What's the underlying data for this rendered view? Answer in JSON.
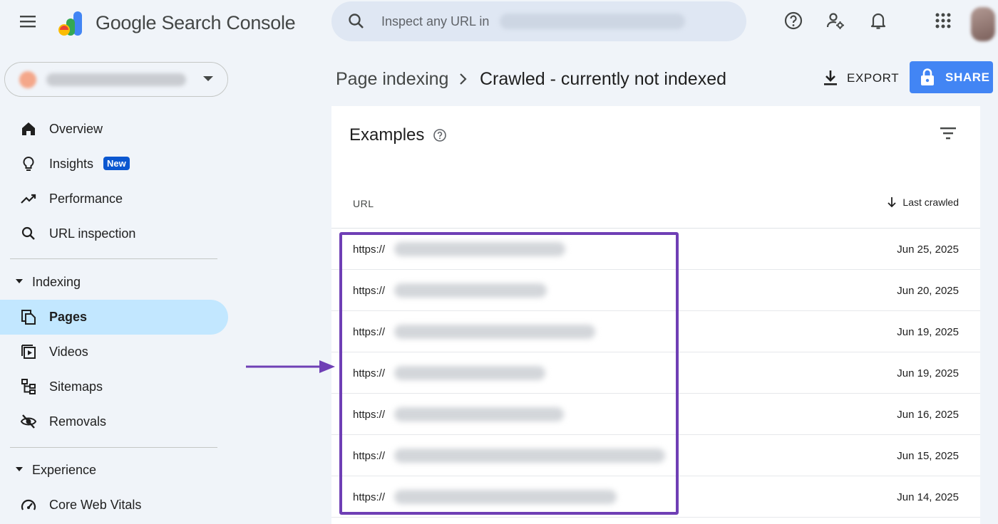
{
  "topbar": {
    "brand": "Google Search Console",
    "search_placeholder": "Inspect any URL in",
    "icons": [
      "menu-icon",
      "help-icon",
      "manage-users-icon",
      "notifications-icon",
      "apps-icon",
      "avatar"
    ]
  },
  "sidebar": {
    "items": [
      {
        "label": "Overview",
        "icon": "home-icon"
      },
      {
        "label": "Insights",
        "icon": "lightbulb-icon",
        "badge": "New"
      },
      {
        "label": "Performance",
        "icon": "trending-icon"
      },
      {
        "label": "URL inspection",
        "icon": "search-icon"
      }
    ],
    "indexing": {
      "label": "Indexing",
      "items": [
        {
          "label": "Pages",
          "icon": "pages-icon",
          "active": true
        },
        {
          "label": "Videos",
          "icon": "video-icon"
        },
        {
          "label": "Sitemaps",
          "icon": "sitemap-icon"
        },
        {
          "label": "Removals",
          "icon": "eye-off-icon"
        }
      ]
    },
    "experience": {
      "label": "Experience",
      "items": [
        {
          "label": "Core Web Vitals",
          "icon": "gauge-icon"
        }
      ]
    }
  },
  "header": {
    "breadcrumb_parent": "Page indexing",
    "breadcrumb_current": "Crawled - currently not indexed",
    "export_label": "EXPORT",
    "share_label": "SHARE"
  },
  "card": {
    "title": "Examples",
    "columns": {
      "url": "URL",
      "last_crawled": "Last crawled"
    },
    "rows": [
      {
        "url": "https://",
        "date": "Jun 25, 2025"
      },
      {
        "url": "https://",
        "date": "Jun 20, 2025"
      },
      {
        "url": "https://",
        "date": "Jun 19, 2025"
      },
      {
        "url": "https://",
        "date": "Jun 19, 2025"
      },
      {
        "url": "https://",
        "date": "Jun 16, 2025"
      },
      {
        "url": "https://",
        "date": "Jun 15, 2025"
      },
      {
        "url": "https://",
        "date": "Jun 14, 2025"
      }
    ]
  },
  "colors": {
    "accent": "#4285f4",
    "active_nav": "#c2e7ff",
    "badge": "#0b57d0",
    "annotation": "#6f3fb5",
    "background": "#f0f4f9"
  }
}
